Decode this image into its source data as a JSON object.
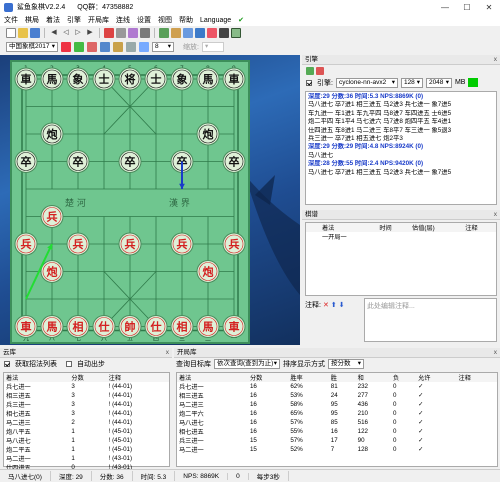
{
  "app": {
    "title": "鲨鱼象棋V2.2.4",
    "qq": "QQ群：47358882"
  },
  "window_buttons": [
    "—",
    "☐",
    "✕"
  ],
  "menu": [
    "文件",
    "棋局",
    "着法",
    "引擎",
    "开局库",
    "连线",
    "设置",
    "视图",
    "帮助",
    "Language",
    "✔"
  ],
  "toolbar2": {
    "rule": "中国象棋2017",
    "speed": "8",
    "zoom_label": "缩放:"
  },
  "colors": {
    "accent": "#00cc00",
    "blue_text": "#1a3cc9",
    "board": "#6fc68f",
    "red": "#d42020",
    "black": "#111111"
  },
  "board": {
    "top_files": [
      "1",
      "2",
      "3",
      "4",
      "5",
      "6",
      "7",
      "8",
      "9"
    ],
    "bottom_files": [
      "九",
      "八",
      "七",
      "六",
      "五",
      "四",
      "三",
      "二",
      "一"
    ],
    "river_left": "楚 河",
    "river_right": "漢 界",
    "pieces": [
      {
        "ch": "車",
        "side": "black",
        "c": 0,
        "r": 0
      },
      {
        "ch": "馬",
        "side": "black",
        "c": 1,
        "r": 0
      },
      {
        "ch": "象",
        "side": "black",
        "c": 2,
        "r": 0
      },
      {
        "ch": "士",
        "side": "black",
        "c": 3,
        "r": 0
      },
      {
        "ch": "将",
        "side": "black",
        "c": 4,
        "r": 0
      },
      {
        "ch": "士",
        "side": "black",
        "c": 5,
        "r": 0
      },
      {
        "ch": "象",
        "side": "black",
        "c": 6,
        "r": 0
      },
      {
        "ch": "馬",
        "side": "black",
        "c": 7,
        "r": 0
      },
      {
        "ch": "車",
        "side": "black",
        "c": 8,
        "r": 0
      },
      {
        "ch": "炮",
        "side": "black",
        "c": 1,
        "r": 2
      },
      {
        "ch": "炮",
        "side": "black",
        "c": 7,
        "r": 2
      },
      {
        "ch": "卒",
        "side": "black",
        "c": 0,
        "r": 3
      },
      {
        "ch": "卒",
        "side": "black",
        "c": 2,
        "r": 3
      },
      {
        "ch": "卒",
        "side": "black",
        "c": 4,
        "r": 3
      },
      {
        "ch": "卒",
        "side": "black",
        "c": 6,
        "r": 3
      },
      {
        "ch": "卒",
        "side": "black",
        "c": 8,
        "r": 3
      },
      {
        "ch": "兵",
        "side": "red",
        "c": 0,
        "r": 6
      },
      {
        "ch": "兵",
        "side": "red",
        "c": 2,
        "r": 6
      },
      {
        "ch": "兵",
        "side": "red",
        "c": 4,
        "r": 6
      },
      {
        "ch": "兵",
        "side": "red",
        "c": 6,
        "r": 6
      },
      {
        "ch": "兵",
        "side": "red",
        "c": 8,
        "r": 6
      },
      {
        "ch": "兵",
        "side": "red",
        "c": 1,
        "r": 5
      },
      {
        "ch": "炮",
        "side": "red",
        "c": 1,
        "r": 7
      },
      {
        "ch": "炮",
        "side": "red",
        "c": 7,
        "r": 7
      },
      {
        "ch": "車",
        "side": "red",
        "c": 0,
        "r": 9
      },
      {
        "ch": "馬",
        "side": "red",
        "c": 1,
        "r": 9
      },
      {
        "ch": "相",
        "side": "red",
        "c": 2,
        "r": 9
      },
      {
        "ch": "仕",
        "side": "red",
        "c": 3,
        "r": 9
      },
      {
        "ch": "帥",
        "side": "red",
        "c": 4,
        "r": 9
      },
      {
        "ch": "仕",
        "side": "red",
        "c": 5,
        "r": 9
      },
      {
        "ch": "相",
        "side": "red",
        "c": 6,
        "r": 9
      },
      {
        "ch": "馬",
        "side": "red",
        "c": 7,
        "r": 9
      },
      {
        "ch": "車",
        "side": "red",
        "c": 8,
        "r": 9
      }
    ],
    "arrows": [
      {
        "color": "#1a3cc9",
        "from": [
          6,
          3
        ],
        "to": [
          6,
          4
        ]
      },
      {
        "color": "#22dd33",
        "from": [
          0,
          8
        ],
        "to": [
          1,
          6
        ]
      }
    ]
  },
  "engine": {
    "header": "引擎",
    "close": "x",
    "engine_label": "引擎:",
    "engine_name": "cyclone-nn-avx2",
    "threads": "128",
    "hash": "2048",
    "hash_unit": "MB",
    "lines": [
      {
        "bold": true,
        "text": "深度:29  分数:36  时间:5.3  NPS:8869K (0)"
      },
      {
        "bold": false,
        "text": "马八进七 卒7进1 相三进五 马2进3 兵七进一 象7进5"
      },
      {
        "bold": false,
        "text": "车九进一 车1进1 车九平四 马8进7 车四进五 士6进5"
      },
      {
        "bold": false,
        "text": "炮二平四 车1平4 马七进六 马7进8 炮四平五 车4进1"
      },
      {
        "bold": false,
        "text": "仕四进五 车8进1 马二进三 车8平7 车三进一 象5退3"
      },
      {
        "bold": false,
        "text": "兵三进一 卒7进1 相五进七 炮2平3"
      },
      {
        "bold": true,
        "text": "深度:29  分数:29  时间:4.8  NPS:8924K (0)"
      },
      {
        "bold": false,
        "text": "马八进七"
      },
      {
        "bold": true,
        "text": "深度:28  分数:55  时间:2.4  NPS:9420K (0)"
      },
      {
        "bold": false,
        "text": "马八进七 卒7进1 相三进五 马2进3 兵七进一 象7进5"
      }
    ]
  },
  "movelist": {
    "header": "棋谱",
    "cols": [
      "着法",
      "时间",
      "估值(层)",
      "注释"
    ],
    "rows": [
      [
        "一开局一",
        "",
        "",
        ""
      ]
    ],
    "comment_label": "注释:",
    "comment_placeholder": "此处编辑注释..."
  },
  "cloud": {
    "header": "云库",
    "opt1": "获取招法列表",
    "opt2": "自动出步",
    "cols": [
      "着法",
      "分数",
      "注释"
    ],
    "rows": [
      [
        "兵七进一",
        "3",
        "! (44-01)"
      ],
      [
        "相三进五",
        "3",
        "! (44-01)"
      ],
      [
        "兵三进一",
        "3",
        "! (44-01)"
      ],
      [
        "相七进五",
        "3",
        "! (44-01)"
      ],
      [
        "马二进三",
        "2",
        "! (44-01)"
      ],
      [
        "炮八平五",
        "1",
        "! (45-01)"
      ],
      [
        "马八进七",
        "1",
        "! (45-01)"
      ],
      [
        "炮二平五",
        "1",
        "! (45-01)"
      ],
      [
        "马二进一",
        "1",
        "! (43-01)"
      ],
      [
        "仕四进五",
        "0",
        "! (43-01)"
      ]
    ]
  },
  "opening": {
    "header": "开局库",
    "mode_label": "查询目标库",
    "mode_value": "依次查询(查到为止)",
    "sort_label": "排序显示方式",
    "sort_value": "按分数",
    "cols": [
      "着法",
      "分数",
      "胜率",
      "胜",
      "和",
      "负",
      "允许",
      "注释"
    ],
    "rows": [
      [
        "兵七进一",
        "16",
        "62%",
        "81",
        "232",
        "0",
        "✓",
        ""
      ],
      [
        "相三进五",
        "16",
        "53%",
        "24",
        "277",
        "0",
        "✓",
        ""
      ],
      [
        "马二进三",
        "16",
        "58%",
        "95",
        "436",
        "0",
        "✓",
        ""
      ],
      [
        "炮二平六",
        "16",
        "65%",
        "95",
        "210",
        "0",
        "✓",
        ""
      ],
      [
        "马八进七",
        "16",
        "57%",
        "85",
        "516",
        "0",
        "✓",
        ""
      ],
      [
        "相七进五",
        "16",
        "55%",
        "16",
        "122",
        "0",
        "✓",
        ""
      ],
      [
        "兵三进一",
        "15",
        "57%",
        "17",
        "90",
        "0",
        "✓",
        ""
      ],
      [
        "马二进一",
        "15",
        "52%",
        "7",
        "128",
        "0",
        "✓",
        ""
      ]
    ]
  },
  "status": {
    "move": "马八进七(0)",
    "depth": "深度: 29",
    "score": "分数: 36",
    "time": "时间: 5.3",
    "nps": "NPS: 8869K",
    "s5": "0",
    "s6": "每步3秒"
  }
}
